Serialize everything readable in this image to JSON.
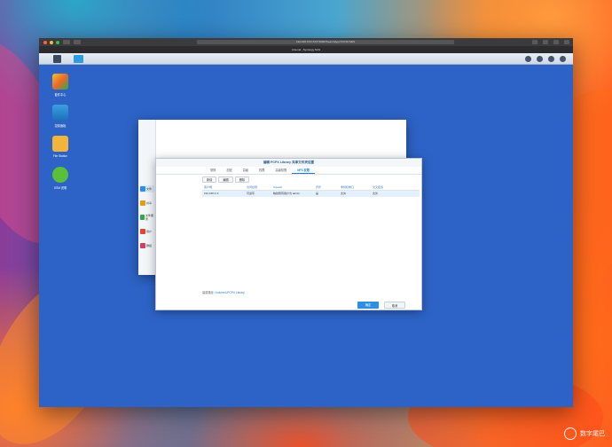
{
  "browser": {
    "url": "192.168.XXX.XXX:5000/?launchApp=SYNO.SDS",
    "tab_title": "Arsenal - Synology NAS"
  },
  "desktop": {
    "icons": [
      {
        "label": "套件中心",
        "icon": "package-center-icon"
      },
      {
        "label": "控制面板",
        "icon": "control-panel-icon"
      },
      {
        "label": "File Station",
        "icon": "file-station-icon"
      },
      {
        "label": "DSM 说明",
        "icon": "help-icon"
      }
    ]
  },
  "sidebar": {
    "items": [
      {
        "label": "文件",
        "color": "#2f8ee0"
      },
      {
        "label": "共享",
        "color": "#e89a1a"
      },
      {
        "label": "文件服务",
        "color": "#2fa84a"
      },
      {
        "label": "用户",
        "color": "#e04a2a"
      },
      {
        "label": "群组",
        "color": "#d04060"
      },
      {
        "label": "域",
        "color": "#2f8ee0"
      },
      {
        "label": "外部",
        "color": "#3aa0d8"
      },
      {
        "label": "安全",
        "color": "#2f8ee0"
      },
      {
        "label": "网络",
        "color": "#d04a4a"
      },
      {
        "label": "DHCP",
        "color": "#3a8ad0"
      }
    ]
  },
  "dialog": {
    "title": "编辑 PCPX Library 共享文件夹设置",
    "tabs": [
      "常规",
      "加密",
      "高级",
      "权限",
      "高级权限",
      "NFS 权限"
    ],
    "active_tab": "NFS 权限",
    "toolbar": {
      "create": "新增",
      "edit": "编辑",
      "delete": "删除"
    },
    "columns": [
      "客户端",
      "访问权限",
      "Squash",
      "异步",
      "非特权端口",
      "交叉挂载"
    ],
    "rows": [
      [
        "192.168.X.X",
        "可读写",
        "映射所有用户为 admin",
        "是",
        "允许",
        "允许"
      ]
    ],
    "mount_path_label": "装载路径:",
    "mount_path": "/volume1/PCPX Library",
    "ok_label": "确定",
    "cancel_label": "取消"
  },
  "watermark": {
    "text": "数字尾巴"
  }
}
